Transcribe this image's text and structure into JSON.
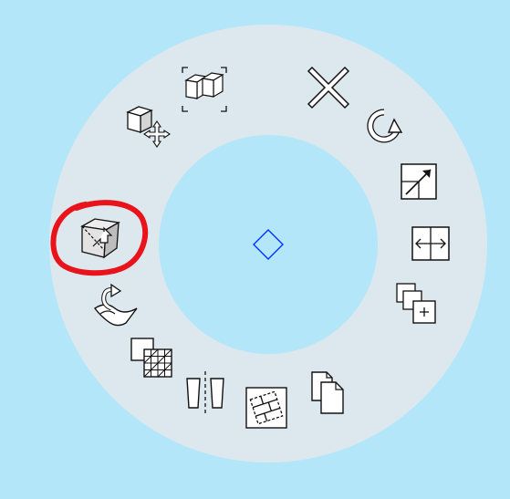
{
  "pie_menu": {
    "center": {
      "icon": "diamond-icon",
      "color": "#0033ff"
    },
    "tools": [
      {
        "id": "close",
        "icon": "close-x-icon"
      },
      {
        "id": "rotate",
        "icon": "rotate-refresh-icon"
      },
      {
        "id": "scale",
        "icon": "resize-diagonal-icon"
      },
      {
        "id": "stretch",
        "icon": "stretch-horizontal-icon"
      },
      {
        "id": "multiply",
        "icon": "add-copies-icon"
      },
      {
        "id": "duplicate",
        "icon": "duplicate-pages-icon"
      },
      {
        "id": "tile",
        "icon": "tile-pattern-icon"
      },
      {
        "id": "mirror",
        "icon": "mirror-split-icon"
      },
      {
        "id": "fill-hatch",
        "icon": "hatch-fill-icon"
      },
      {
        "id": "project-surface",
        "icon": "project-to-surface-icon"
      },
      {
        "id": "offset-3d",
        "icon": "offset-solid-icon"
      },
      {
        "id": "move-3d",
        "icon": "move-object-3d-icon"
      },
      {
        "id": "select-boxes",
        "icon": "select-boxes-icon"
      }
    ]
  },
  "annotation": {
    "color": "#e8131b",
    "target": "offset-3d"
  }
}
